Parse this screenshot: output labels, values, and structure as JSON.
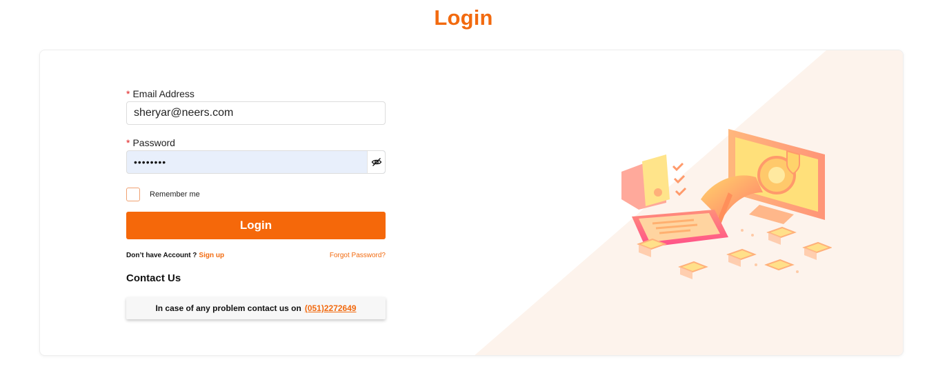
{
  "page": {
    "title": "Login"
  },
  "form": {
    "email": {
      "label": "Email Address",
      "required_mark": "*",
      "value": "sheryar@neers.com"
    },
    "password": {
      "label": "Password",
      "required_mark": "*",
      "masked_value": "••••••••",
      "toggle_icon": "eye-slash-icon"
    },
    "remember": {
      "label": "Remember me",
      "checked": false
    },
    "submit_label": "Login",
    "no_account_text": "Don’t have Account ?",
    "signup_label": "Sign up",
    "forgot_label": "Forgot Password?"
  },
  "contact": {
    "title": "Contact Us",
    "text": "In case of any problem contact us on",
    "phone": "(051)2272649"
  },
  "colors": {
    "accent": "#f26a0f",
    "button": "#f5680a",
    "background_tint": "#fdf3ec"
  }
}
